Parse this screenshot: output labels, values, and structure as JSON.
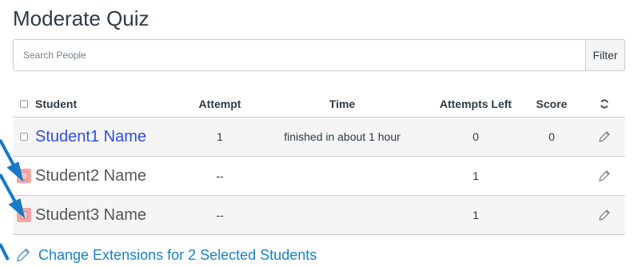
{
  "header": {
    "title": "Moderate Quiz"
  },
  "search": {
    "placeholder": "Search People",
    "value": "",
    "filter_label": "Filter"
  },
  "table": {
    "columns": {
      "student": "Student",
      "attempt": "Attempt",
      "time": "Time",
      "attempts_left": "Attempts Left",
      "score": "Score"
    },
    "rows": [
      {
        "name": "Student1 Name",
        "attempt": "1",
        "time": "finished in about 1 hour",
        "attempts_left": "0",
        "score": "0",
        "selected": false,
        "highlighted": false,
        "is_link": true
      },
      {
        "name": "Student2 Name",
        "attempt": "--",
        "time": "",
        "attempts_left": "1",
        "score": "",
        "selected": true,
        "highlighted": true,
        "is_link": false
      },
      {
        "name": "Student3 Name",
        "attempt": "--",
        "time": "",
        "attempts_left": "1",
        "score": "",
        "selected": true,
        "highlighted": true,
        "is_link": false
      }
    ]
  },
  "footer": {
    "change_extensions_label": "Change Extensions for 2 Selected Students"
  },
  "icons": {
    "refresh": "refresh-icon",
    "edit": "pencil-icon"
  },
  "colors": {
    "link": "#2e4ce6",
    "action_link": "#1a82c4",
    "highlight": "#f4a6a6",
    "annotation_arrow": "#1a78c8"
  }
}
